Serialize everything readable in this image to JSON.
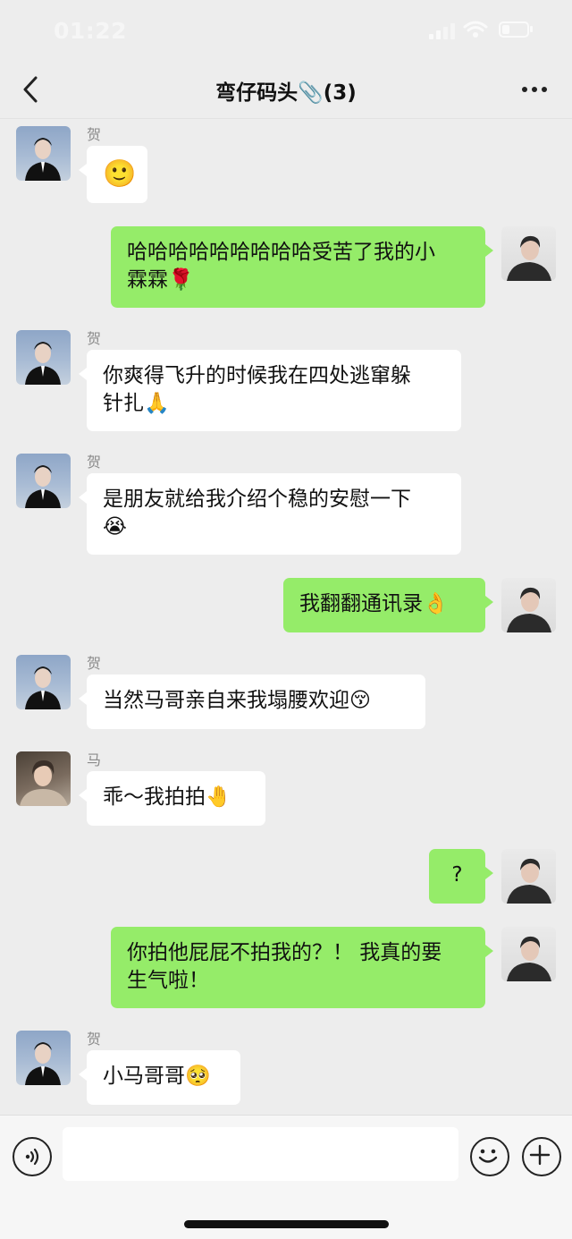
{
  "status_bar": {
    "time": "01:22"
  },
  "header": {
    "title": "弯仔码头📎(3)"
  },
  "messages": [
    {
      "sender": "贺儿",
      "text": "🙂",
      "direction": "in",
      "avatar": "person-in-black-suit"
    },
    {
      "sender": "",
      "text": "哈哈哈哈哈哈哈哈哈受苦了我的小\n霖霖🌹",
      "direction": "out",
      "avatar": "person-dark-jacket"
    },
    {
      "sender": "贺儿",
      "text": "你爽得飞升的时候我在四处逃窜躲\n针扎🙏",
      "direction": "in",
      "avatar": "person-in-black-suit"
    },
    {
      "sender": "贺儿",
      "text": "是朋友就给我介绍个稳的安慰一下\n😭",
      "direction": "in",
      "avatar": "person-in-black-suit"
    },
    {
      "sender": "",
      "text": "我翻翻通讯录👌",
      "direction": "out",
      "avatar": "person-dark-jacket"
    },
    {
      "sender": "贺儿",
      "text": "当然马哥亲自来我塌腰欢迎😚",
      "direction": "in",
      "avatar": "person-in-black-suit"
    },
    {
      "sender": "马哥",
      "text": "乖～我拍拍🤚",
      "direction": "in",
      "avatar": "person-in-beige-sweater"
    },
    {
      "sender": "",
      "text": "?",
      "direction": "out",
      "avatar": "person-dark-jacket"
    },
    {
      "sender": "",
      "text": "你拍他屁屁不拍我的？！ 我真的要\n生气啦！",
      "direction": "out",
      "avatar": "person-dark-jacket"
    },
    {
      "sender": "贺儿",
      "text": "小马哥哥🥺",
      "direction": "in",
      "avatar": "person-in-black-suit"
    }
  ],
  "input_bar": {
    "placeholder": ""
  },
  "colors": {
    "background": "#ededed",
    "bubble_out": "#95ec69",
    "bubble_in": "#ffffff",
    "name": "#8a8a8a"
  },
  "icons": [
    "back-chevron-icon",
    "more-dots-icon",
    "voice-icon",
    "emoji-icon",
    "plus-icon",
    "wifi-icon",
    "signal-icon",
    "battery-icon"
  ]
}
